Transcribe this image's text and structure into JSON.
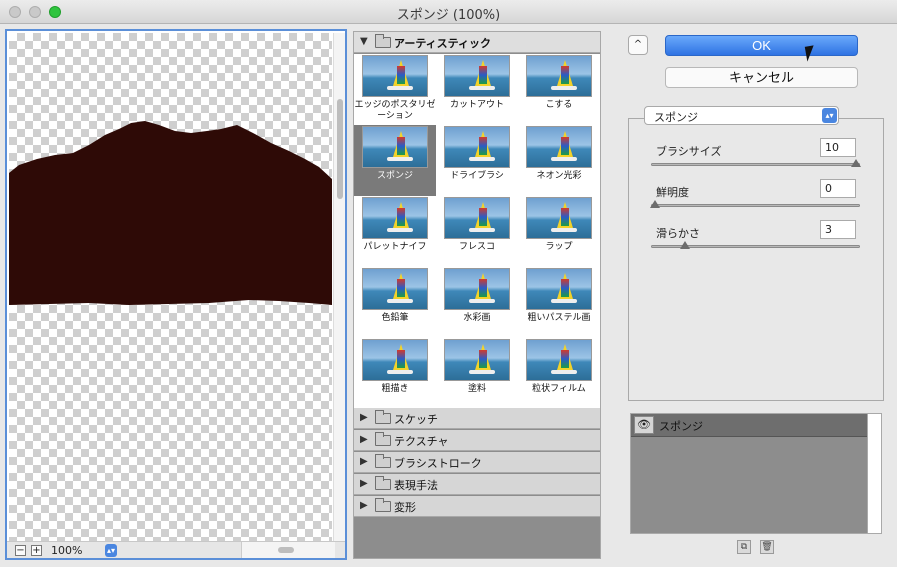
{
  "window": {
    "title": "スポンジ (100%)"
  },
  "preview": {
    "zoom_out": "−",
    "zoom_in": "+",
    "zoom": "100%",
    "zoom_select": "▴▾",
    "image_fill": "#2e0a06"
  },
  "gallery": {
    "open_category": "アーティスティック",
    "open_arrow": "▼",
    "closed_arrow": "▶",
    "filters": [
      "エッジのポスタリゼーション",
      "カットアウト",
      "こする",
      "スポンジ",
      "ドライブラシ",
      "ネオン光彩",
      "パレットナイフ",
      "フレスコ",
      "ラップ",
      "色鉛筆",
      "水彩画",
      "粗いパステル画",
      "粗描き",
      "塗料",
      "粒状フィルム"
    ],
    "selected": "スポンジ",
    "categories": [
      "スケッチ",
      "テクスチャ",
      "ブラシストローク",
      "表現手法",
      "変形"
    ]
  },
  "actions": {
    "collapse": "^",
    "ok": "OK",
    "cancel": "キャンセル"
  },
  "settings": {
    "filter_select": "スポンジ",
    "select_arrow": "▴▾",
    "params": [
      {
        "label": "ブラシサイズ",
        "value": "10",
        "level": 1.0
      },
      {
        "label": "鮮明度",
        "value": "0",
        "level": 0.0
      },
      {
        "label": "滑らかさ",
        "value": "3",
        "level": 0.15
      }
    ]
  },
  "layers": {
    "eye": "👁",
    "items": [
      {
        "name": "スポンジ"
      }
    ],
    "new_layer_icon": "⧉",
    "delete_icon": "🗑"
  },
  "colors": {
    "accent": "#2f73e3",
    "selected_thumb": "#7a7a7a"
  }
}
